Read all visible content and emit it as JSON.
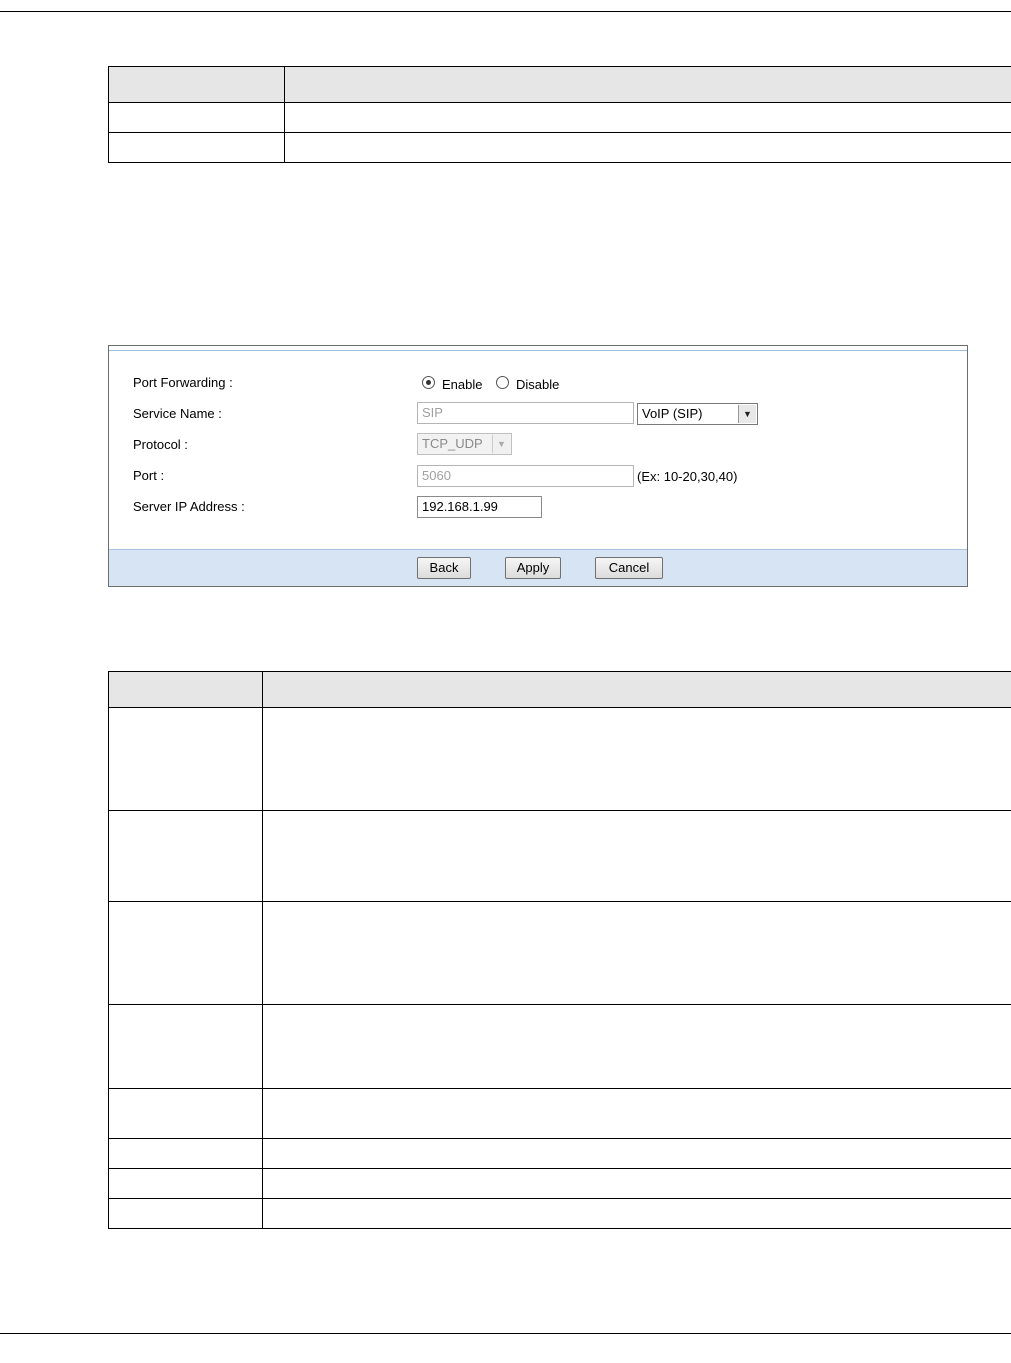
{
  "port_forwarding": {
    "label": "Port Forwarding :",
    "options": [
      {
        "label": "Enable",
        "selected": true
      },
      {
        "label": "Disable",
        "selected": false
      }
    ]
  },
  "service_name": {
    "label": "Service Name :",
    "value": "SIP",
    "select_value": "VoIP (SIP)"
  },
  "protocol": {
    "label": "Protocol :",
    "value": "TCP_UDP"
  },
  "port": {
    "label": "Port :",
    "value": "5060",
    "hint": "(Ex: 10-20,30,40)"
  },
  "server_ip": {
    "label": "Server IP Address :",
    "value": "192.168.1.99"
  },
  "buttons": {
    "back": "Back",
    "apply": "Apply",
    "cancel": "Cancel"
  },
  "colors": {
    "footer": "#d6e4f3",
    "header_cell": "#e6e6e6"
  },
  "icons": {
    "dropdown": "chevron-down-icon",
    "radio": "radio-icon"
  }
}
